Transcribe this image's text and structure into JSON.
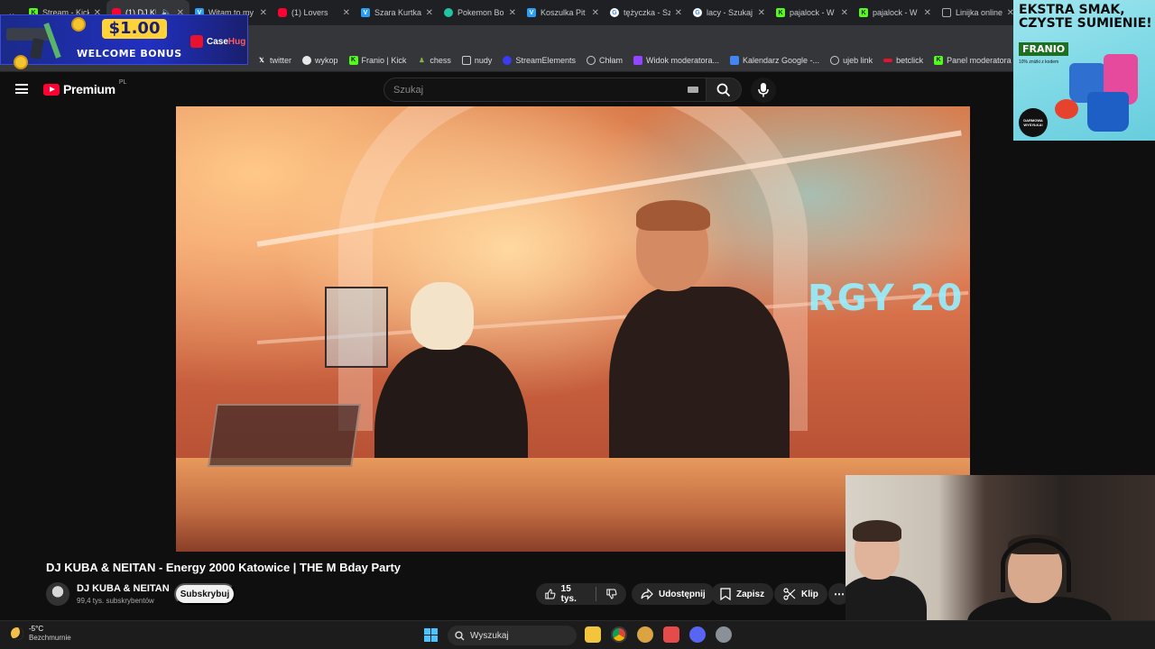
{
  "browser": {
    "tabs": [
      {
        "title": "Stream - Kick",
        "favicon": "kick-icon",
        "active": false
      },
      {
        "title": "(1) DJ KUBA",
        "favicon": "youtube-icon",
        "active": true
      },
      {
        "title": "Witam to my",
        "favicon": "vertical-icon",
        "active": false
      },
      {
        "title": "(1) Lovers",
        "favicon": "youtube-icon",
        "active": false
      },
      {
        "title": "Szara Kurtka",
        "favicon": "vertical-icon",
        "active": false
      },
      {
        "title": "Pokemon Bo",
        "favicon": "pokemon-icon",
        "active": false
      },
      {
        "title": "Koszulka Pit",
        "favicon": "vertical-icon",
        "active": false
      },
      {
        "title": "tężyczka - Sz",
        "favicon": "google-icon",
        "active": false
      },
      {
        "title": "lacy - Szukaj",
        "favicon": "google-icon",
        "active": false
      },
      {
        "title": "pajalock - W",
        "favicon": "kick-icon",
        "active": false
      },
      {
        "title": "pajalock - W",
        "favicon": "kick-icon",
        "active": false
      },
      {
        "title": "Linijka online",
        "favicon": "document-icon",
        "active": false
      }
    ],
    "bookmarks": [
      {
        "label": "twitter",
        "icon": "x-icon"
      },
      {
        "label": "wykop",
        "icon": "wykop-icon"
      },
      {
        "label": "Franio | Kick",
        "icon": "kick-icon"
      },
      {
        "label": "chess",
        "icon": "chess-icon"
      },
      {
        "label": "nudy",
        "icon": "folder-icon"
      },
      {
        "label": "StreamElements",
        "icon": "streamelements-icon"
      },
      {
        "label": "Chłam",
        "icon": "globe-icon"
      },
      {
        "label": "Widok moderatora...",
        "icon": "twitch-icon"
      },
      {
        "label": "Kalendarz Google -...",
        "icon": "calendar-icon"
      },
      {
        "label": "ujeb link",
        "icon": "globe-icon"
      },
      {
        "label": "betclick",
        "icon": "betclick-icon"
      },
      {
        "label": "Panel moderatora |...",
        "icon": "kick-icon"
      }
    ]
  },
  "casino_ad": {
    "amount": "$1.00",
    "bonus_text": "WELCOME BONUS",
    "brand_left": "Case",
    "brand_right": "Hug"
  },
  "youtube": {
    "logo_text": "Premium",
    "region": "PL",
    "search_placeholder": "Szukaj"
  },
  "video": {
    "overlay_text": "RGY 20",
    "title": "DJ KUBA & NEITAN - Energy 2000 Katowice | THE M Bday Party",
    "channel_name": "DJ KUBA & NEITAN",
    "subscribers": "99,4 tys. subskrybentów",
    "subscribe_label": "Subskrybuj",
    "likes": "15 tys.",
    "share_label": "Udostępnij",
    "save_label": "Zapisz",
    "clip_label": "Klip"
  },
  "food_ad": {
    "headline": "EKSTRA SMAK, CZYSTE SUMIENIE!",
    "brand": "FRANIO",
    "subtext": "10% zniżki z kodem",
    "badge": "DARMOWA WYSYŁKA!"
  },
  "taskbar": {
    "temperature": "-5°C",
    "weather": "Bezchmurnie",
    "search_placeholder": "Wyszukaj"
  },
  "colors": {
    "youtube_red": "#ff0033",
    "kick_green": "#53fc18",
    "windows_blue": "#4cc2ff"
  }
}
